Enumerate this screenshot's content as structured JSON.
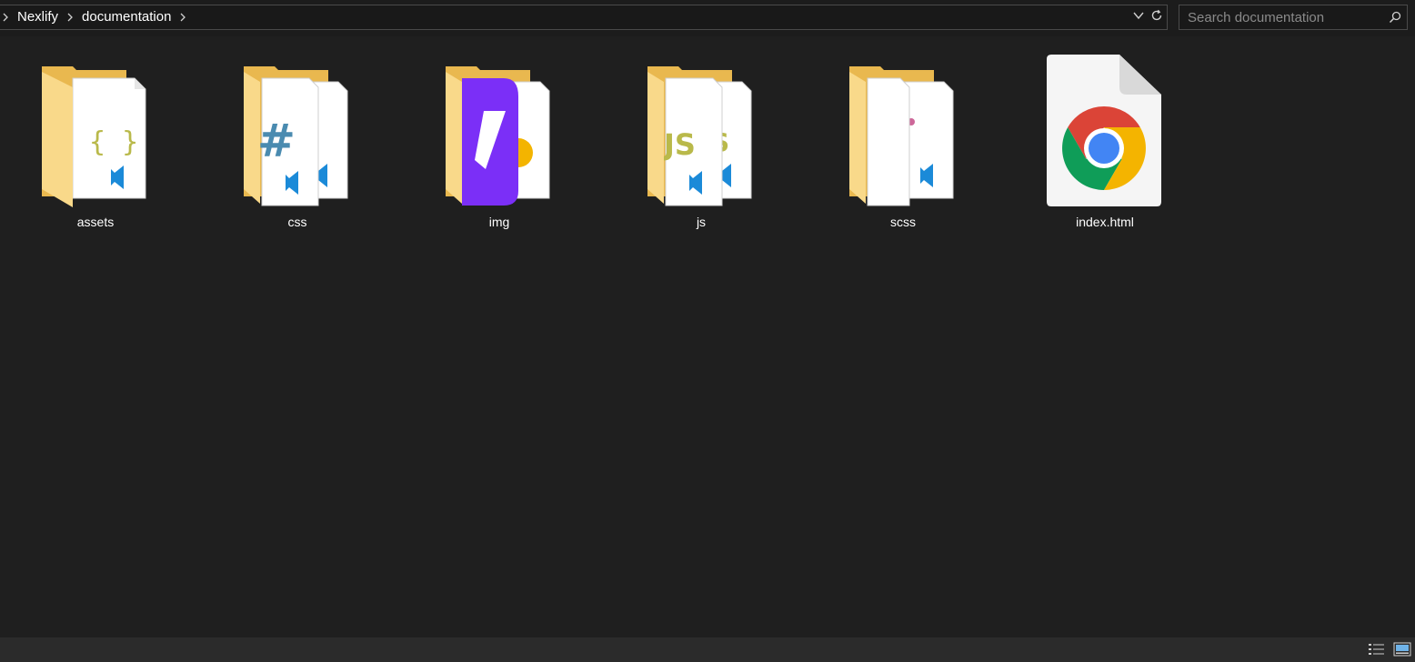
{
  "breadcrumb": {
    "items": [
      "Nexlify",
      "documentation"
    ]
  },
  "search": {
    "placeholder": "Search documentation"
  },
  "icons": {
    "expand": "chevron-down-icon",
    "refresh": "refresh-icon",
    "search": "search-icon",
    "details_view": "details-view-icon",
    "large_icons_view": "large-icons-view-icon"
  },
  "items": [
    {
      "name": "assets",
      "type": "folder",
      "preview": "json"
    },
    {
      "name": "css",
      "type": "folder",
      "preview": "css"
    },
    {
      "name": "img",
      "type": "folder",
      "preview": "image"
    },
    {
      "name": "js",
      "type": "folder",
      "preview": "js"
    },
    {
      "name": "scss",
      "type": "folder",
      "preview": "scss"
    },
    {
      "name": "index.html",
      "type": "file",
      "preview": "chrome"
    }
  ],
  "colors": {
    "background": "#1f1f1f",
    "folder": "#f5d27a",
    "accent": "#0e78c8"
  }
}
